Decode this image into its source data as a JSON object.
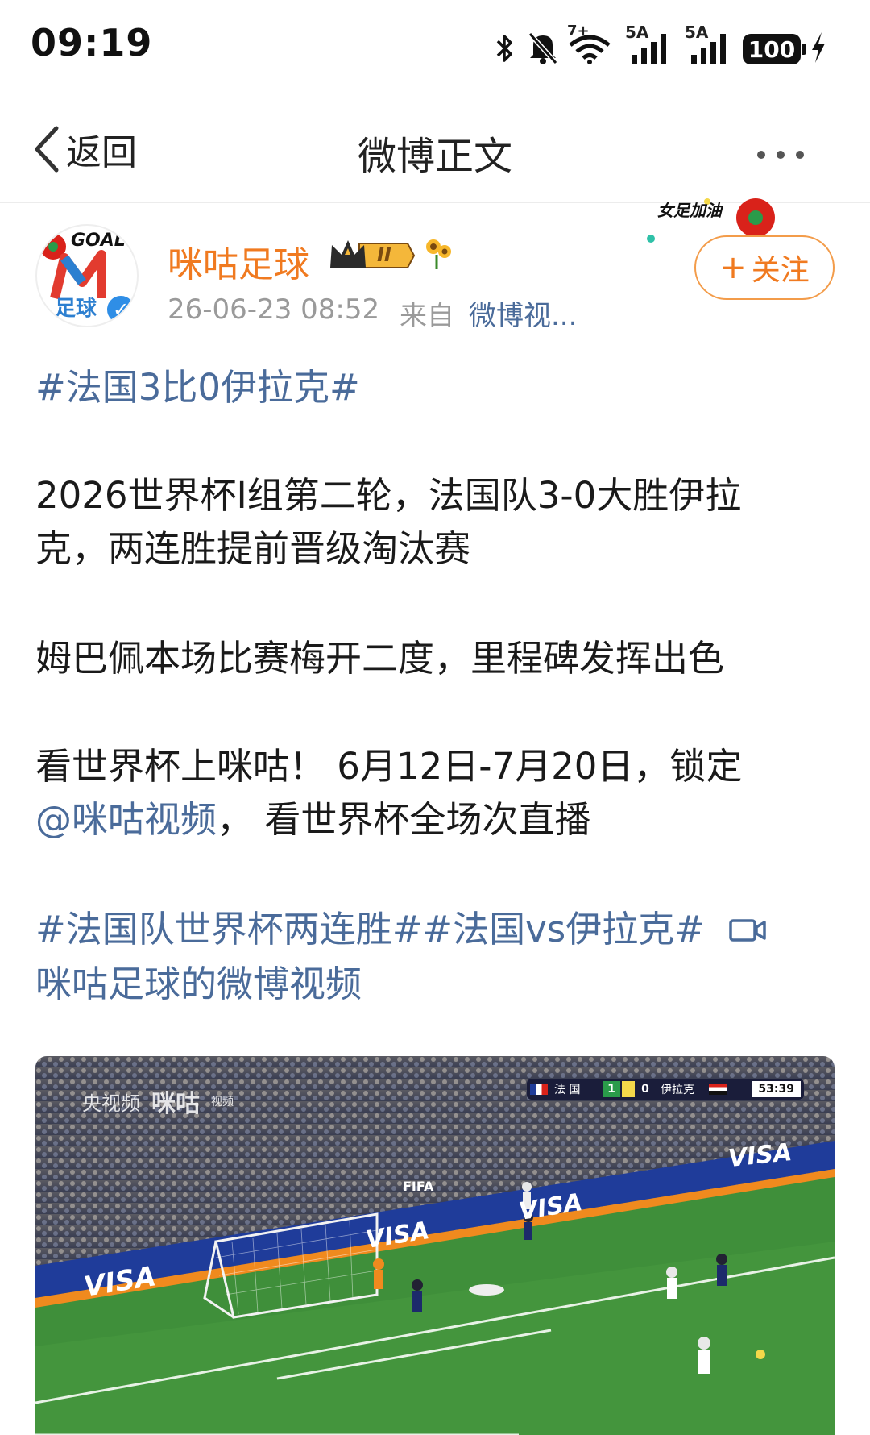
{
  "status_bar": {
    "time": "09:19",
    "wifi_label": "7+",
    "signal1_label": "5A",
    "signal2_label": "5A",
    "battery": "100",
    "icons": [
      "bluetooth-icon",
      "mute-bell-icon",
      "wifi-icon",
      "signal-icon",
      "signal-icon",
      "battery-icon",
      "charging-icon"
    ]
  },
  "nav": {
    "back_label": "返回",
    "title": "微博正文"
  },
  "author": {
    "name": "咪咕足球",
    "avatar_text_top": "GOAL",
    "avatar_text_bottom": "足球",
    "badge_level": "II",
    "time": "26-06-23 08:52",
    "from_label": "来自",
    "source": "微博视...",
    "follow_label": "关注",
    "sticker_text": "女足加油"
  },
  "post": {
    "hashtag1": "#法国3比0伊拉克#",
    "para1_line1": "2026世界杯I组第二轮，法国队3-0大胜伊拉",
    "para1_line2": "克，两连胜提前晋级淘汰赛",
    "para2": "姆巴佩本场比赛梅开二度，里程碑发挥出色",
    "para3_line1": "看世界杯上咪咕！ 6月12日-7月20日，锁定",
    "mention": "@咪咕视频",
    "para3_rest": "， 看世界杯全场次直播",
    "hashtags2": "#法国队世界杯两连胜##法国vs伊拉克#",
    "video_link": "咪咕足球的微博视频"
  },
  "video": {
    "watermark1": "央视频",
    "watermark2": "咪咕",
    "watermark_sub": "视频",
    "team1": "法 国",
    "score1": "1",
    "score2": "0",
    "team2": "伊拉克",
    "clock": "53:39",
    "ad_text": "VISA",
    "board_text": "FIFA"
  },
  "colors": {
    "link": "#4a6b9a",
    "author": "#f07a20",
    "follow_border": "#f39c4a",
    "pitch": "#3f8f3a"
  }
}
